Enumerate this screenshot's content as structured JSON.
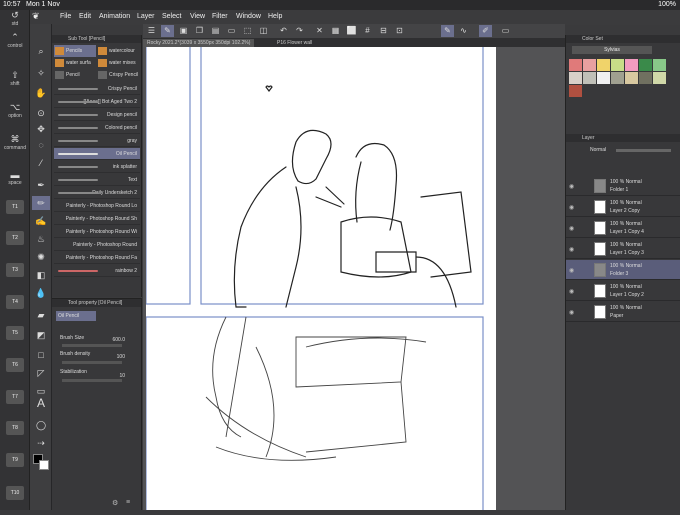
{
  "status": {
    "time": "10:57",
    "date": "Mon 1 Nov",
    "battery": "100%"
  },
  "menu": [
    "File",
    "Edit",
    "Animation",
    "Layer",
    "Select",
    "View",
    "Filter",
    "Window",
    "Help"
  ],
  "left_commands": [
    {
      "label": "ctrl",
      "icon": "⌃"
    },
    {
      "label": "control",
      "icon": "⌃"
    },
    {
      "label": "shift",
      "icon": "⇧"
    },
    {
      "label": "option",
      "icon": "⌥"
    },
    {
      "label": "command",
      "icon": "⌘"
    },
    {
      "label": "space",
      "icon": "▬"
    }
  ],
  "t_keys": [
    "T1",
    "T2",
    "T3",
    "T4",
    "T5",
    "T6",
    "T7",
    "T8",
    "T9",
    "T10"
  ],
  "tabs": [
    {
      "label": "Rocky 2021.2*(3039 x 3550px 350dpi 102.2%)"
    },
    {
      "label": "P16 Flower wall"
    }
  ],
  "subtool": {
    "header": "Sub Tool [Pencil]",
    "grid": [
      "Pencils",
      "watercolour",
      "water surfa",
      "water mixes",
      "Pencil",
      "Crispy Pencil"
    ],
    "brushes": [
      "Crispy Pencil",
      "[[Aaaa]] Bot Aged Two 2",
      "Design pencil",
      "Colored pencil",
      "gray",
      "Oil Pencil",
      "ink splatter",
      "Text",
      "Daily Undersketch 2",
      "Painterly - Photoshop Round Lo",
      "Painterly - Photoshop Round Sh",
      "Painterly - Photoshop Round Wi",
      "Painterly - Photoshop Round",
      "Painterly - Photoshop Round Fa",
      "rainbow 2"
    ]
  },
  "toolprop": {
    "header": "Tool property [Oil Pencil]",
    "brush_name": "Oil Pencil",
    "brush_size_label": "Brush Size",
    "brush_size": "600.0",
    "brush_density_label": "Brush density",
    "brush_density": "100",
    "stabilization_label": "Stabilization",
    "stabilization": "10"
  },
  "colorset": {
    "header": "Color Set",
    "set_name": "Sylvias",
    "swatches": [
      "#e07a7a",
      "#e8a0a0",
      "#f0d36a",
      "#c8dd88",
      "#f29cc0",
      "#3a8a4a",
      "#88c888",
      "#d8d0c8",
      "#c0c0b8",
      "#f0f0f0",
      "#a0a090",
      "#d8c8a0",
      "#707060",
      "#d0d8a8",
      "#b05040"
    ]
  },
  "layers": {
    "header": "Layer",
    "blend": "Normal",
    "rows": [
      {
        "l1": "100 % Normal",
        "l2": "Folder 1",
        "type": "folder"
      },
      {
        "l1": "100 % Normal",
        "l2": "Layer 2 Copy",
        "type": "layer"
      },
      {
        "l1": "100 % Normal",
        "l2": "Layer 1 Copy 4",
        "type": "layer"
      },
      {
        "l1": "100 % Normal",
        "l2": "Layer 1 Copy 3",
        "type": "layer"
      },
      {
        "l1": "100 % Normal",
        "l2": "Folder 3",
        "type": "folder",
        "active": true
      },
      {
        "l1": "100 % Normal",
        "l2": "Layer 1 Copy 2",
        "type": "layer"
      },
      {
        "l1": "100 % Normal",
        "l2": "Paper",
        "type": "paper"
      }
    ]
  }
}
